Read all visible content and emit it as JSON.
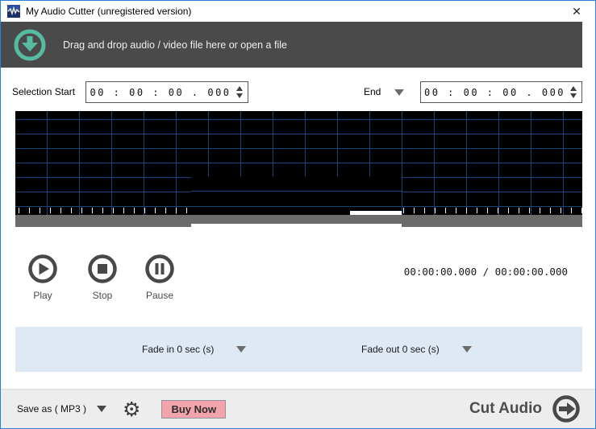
{
  "window": {
    "title": "My Audio Cutter (unregistered version)",
    "close_glyph": "✕"
  },
  "header": {
    "drop_text": "Drag and drop audio / video file here or open a file",
    "icon": "download-circle-icon"
  },
  "selection": {
    "start_label": "Selection Start",
    "start_value": "00 : 00 : 00 . 000",
    "end_label": "End",
    "end_value": "00 : 00 : 00 . 000"
  },
  "transport": {
    "play_label": "Play",
    "stop_label": "Stop",
    "pause_label": "Pause",
    "time_display": "00:00:00.000 / 00:00:00.000"
  },
  "fade": {
    "fade_in_label": "Fade in 0 sec (s)",
    "fade_out_label": "Fade out 0 sec (s)"
  },
  "bottom": {
    "save_as_label": "Save as ( MP3 )",
    "gear_glyph": "⚙",
    "buy_now_label": "Buy Now",
    "cut_audio_label": "Cut Audio"
  },
  "colors": {
    "border_blue": "#2b7fd6",
    "header_bg": "#4a4a4a",
    "accent_teal": "#56bba0",
    "grid_blue": "#16447f",
    "scrollbar_gray": "#6b6b6b",
    "fade_bg": "#dfe9f4",
    "bottombar_bg": "#ededed",
    "buy_now_bg": "#f2a3ab",
    "icon_dark": "#484848"
  }
}
